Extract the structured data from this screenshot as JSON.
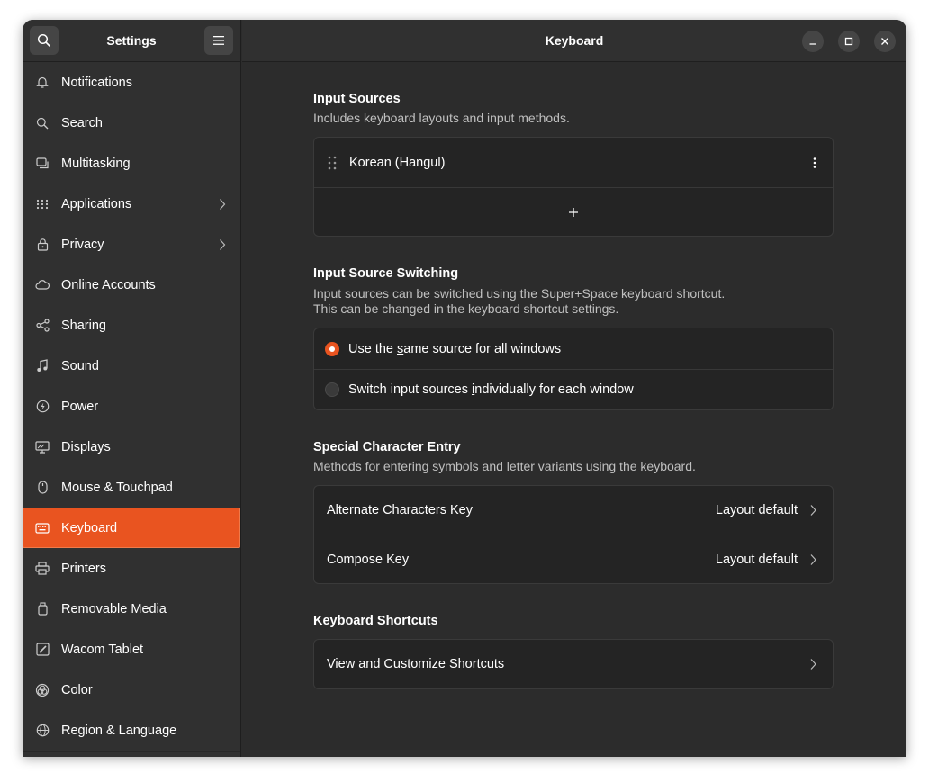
{
  "sidebar": {
    "title": "Settings",
    "items": [
      {
        "label": "Notifications",
        "icon": "bell-icon",
        "chevron": false
      },
      {
        "label": "Search",
        "icon": "search-icon",
        "chevron": false
      },
      {
        "label": "Multitasking",
        "icon": "multitasking-icon",
        "chevron": false
      },
      {
        "label": "Applications",
        "icon": "applications-grid-icon",
        "chevron": true
      },
      {
        "label": "Privacy",
        "icon": "lock-icon",
        "chevron": true
      },
      {
        "label": "Online Accounts",
        "icon": "cloud-icon",
        "chevron": false
      },
      {
        "label": "Sharing",
        "icon": "share-icon",
        "chevron": false
      },
      {
        "label": "Sound",
        "icon": "music-note-icon",
        "chevron": false
      },
      {
        "label": "Power",
        "icon": "power-icon",
        "chevron": false
      },
      {
        "label": "Displays",
        "icon": "display-icon",
        "chevron": false
      },
      {
        "label": "Mouse & Touchpad",
        "icon": "mouse-icon",
        "chevron": false
      },
      {
        "label": "Keyboard",
        "icon": "keyboard-icon",
        "chevron": false,
        "active": true
      },
      {
        "label": "Printers",
        "icon": "printer-icon",
        "chevron": false
      },
      {
        "label": "Removable Media",
        "icon": "usb-drive-icon",
        "chevron": false
      },
      {
        "label": "Wacom Tablet",
        "icon": "tablet-icon",
        "chevron": false
      },
      {
        "label": "Color",
        "icon": "color-icon",
        "chevron": false
      },
      {
        "label": "Region & Language",
        "icon": "globe-icon",
        "chevron": false
      }
    ]
  },
  "header": {
    "title": "Keyboard"
  },
  "input_sources": {
    "title": "Input Sources",
    "description": "Includes keyboard layouts and input methods.",
    "sources": [
      "Korean (Hangul)"
    ]
  },
  "input_source_switching": {
    "title": "Input Source Switching",
    "description_line1": "Input sources can be switched using the Super+Space keyboard shortcut.",
    "description_line2": "This can be changed in the keyboard shortcut settings.",
    "option_same_pre": "Use the ",
    "option_same_u": "s",
    "option_same_post": "ame source for all windows",
    "option_individual_pre": "Switch input sources ",
    "option_individual_u": "i",
    "option_individual_post": "ndividually for each window",
    "selected": "same"
  },
  "special_character_entry": {
    "title": "Special Character Entry",
    "description": "Methods for entering symbols and letter variants using the keyboard.",
    "rows": [
      {
        "label": "Alternate Characters Key",
        "value": "Layout default"
      },
      {
        "label": "Compose Key",
        "value": "Layout default"
      }
    ]
  },
  "keyboard_shortcuts": {
    "title": "Keyboard Shortcuts",
    "row_label": "View and Customize Shortcuts"
  },
  "colors": {
    "accent": "#e95420",
    "window_bg": "#2c2c2c",
    "sidebar_bg": "#303030",
    "card_bg": "#242424"
  }
}
